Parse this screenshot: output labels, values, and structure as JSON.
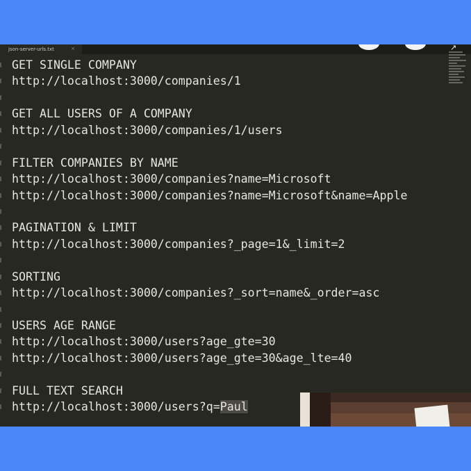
{
  "tab": {
    "filename": "json-server-urls.txt",
    "close_glyph": "×"
  },
  "window_controls": {
    "arrow_glyph": "↗"
  },
  "lines": [
    "GET SINGLE COMPANY",
    "http://localhost:3000/companies/1",
    "",
    "GET ALL USERS OF A COMPANY",
    "http://localhost:3000/companies/1/users",
    "",
    "FILTER COMPANIES BY NAME",
    "http://localhost:3000/companies?name=Microsoft",
    "http://localhost:3000/companies?name=Microsoft&name=Apple",
    "",
    "PAGINATION & LIMIT",
    "http://localhost:3000/companies?_page=1&_limit=2",
    "",
    "SORTING",
    "http://localhost:3000/companies?_sort=name&_order=asc",
    "",
    "USERS AGE RANGE",
    "http://localhost:3000/users?age_gte=30",
    "http://localhost:3000/users?age_gte=30&age_lte=40",
    "",
    "FULL TEXT SEARCH"
  ],
  "last_line": {
    "before_selection": "http://localhost:3000/users?q=",
    "selected": "Paul"
  },
  "colors": {
    "frame": "#4a86f5",
    "editor_bg": "#272822",
    "text": "#e6e6df",
    "selection": "#4b4b43"
  },
  "icons": {
    "close": "close-icon",
    "window_button": "window-button-icon",
    "arrow": "arrow-icon"
  }
}
